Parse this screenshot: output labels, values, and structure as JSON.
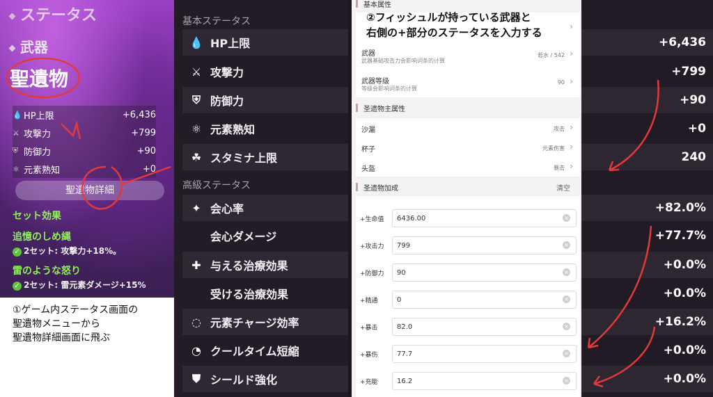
{
  "ingame": {
    "menu": {
      "status": "ステータス",
      "weapon": "武器",
      "artifact": "聖遺物"
    },
    "stats": [
      {
        "icon": "hp-icon",
        "glyph": "💧",
        "label": "HP上限",
        "value": "+6,436"
      },
      {
        "icon": "sword-icon",
        "glyph": "⚔",
        "label": "攻撃力",
        "value": "+799"
      },
      {
        "icon": "shield-icon",
        "glyph": "⛨",
        "label": "防御力",
        "value": "+90"
      },
      {
        "icon": "elemental-mastery-icon",
        "glyph": "⚛",
        "label": "元素熟知",
        "value": "+0"
      }
    ],
    "detail_button": "聖遺物詳細",
    "set_effect_title": "セット効果",
    "sets": [
      {
        "name": "追憶のしめ縄",
        "desc": "2セット: 攻撃力+18%。"
      },
      {
        "name": "雷のような怒り",
        "desc": "2セット: 雷元素ダメージ+15%"
      }
    ],
    "note": "①ゲーム内ステータス画面の\n聖遺物メニューから\n聖遺物詳細画面に飛ぶ"
  },
  "detail": {
    "basic_header": "基本ステータス",
    "advanced_header": "高級ステータス",
    "basic": [
      {
        "icon": "hp-icon",
        "glyph": "💧",
        "label": "HP上限"
      },
      {
        "icon": "sword-icon",
        "glyph": "⚔",
        "label": "攻撃力"
      },
      {
        "icon": "shield-icon",
        "glyph": "⛨",
        "label": "防御力"
      },
      {
        "icon": "elemental-mastery-icon",
        "glyph": "⚛",
        "label": "元素熟知"
      },
      {
        "icon": "stamina-icon",
        "glyph": "☘",
        "label": "スタミナ上限"
      }
    ],
    "advanced": [
      {
        "icon": "crit-rate-icon",
        "glyph": "✦",
        "label": "会心率"
      },
      {
        "icon": "",
        "glyph": "",
        "label": "会心ダメージ"
      },
      {
        "icon": "healing-icon",
        "glyph": "✚",
        "label": "与える治療効果"
      },
      {
        "icon": "",
        "glyph": "",
        "label": "受ける治療効果"
      },
      {
        "icon": "energy-recharge-icon",
        "glyph": "◌",
        "label": "元素チャージ効率"
      },
      {
        "icon": "cooldown-icon",
        "glyph": "◔",
        "label": "クールタイム短縮"
      },
      {
        "icon": "shield-strength-icon",
        "glyph": "⛊",
        "label": "シールド強化"
      }
    ]
  },
  "form": {
    "note": "②フィッシュルが持っている武器と\n右側の+部分のステータスを入力する",
    "sec_basic": "基本属性",
    "weapon_title": "武器",
    "weapon_sub": "武器基础攻击力会影响词条的计算",
    "weapon_value": "若水 / 542",
    "level_title": "武器等级",
    "level_sub": "等级会影响词条的计算",
    "level_value": "90",
    "sec_main": "圣遗物主属性",
    "main": [
      {
        "title": "沙漏",
        "value": "攻击"
      },
      {
        "title": "杯子",
        "value": "元素伤害"
      },
      {
        "title": "头盔",
        "value": "暴击"
      }
    ],
    "sec_bonus": "圣遗物加成",
    "clear": "清空",
    "inputs": [
      {
        "label": "+生命值",
        "value": "6436.00"
      },
      {
        "label": "+攻击力",
        "value": "799"
      },
      {
        "label": "+防御力",
        "value": "90"
      },
      {
        "label": "+精通",
        "value": "0"
      },
      {
        "label": "+暴击",
        "value": "82.0"
      },
      {
        "label": "+暴伤",
        "value": "77.7"
      },
      {
        "label": "+充能",
        "value": "16.2"
      }
    ]
  },
  "values": [
    "+6,436",
    "+799",
    "+90",
    "+0",
    "240",
    "+82.0%",
    "+77.7%",
    "+0.0%",
    "+0.0%",
    "+16.2%",
    "+0.0%",
    "+0.0%"
  ]
}
